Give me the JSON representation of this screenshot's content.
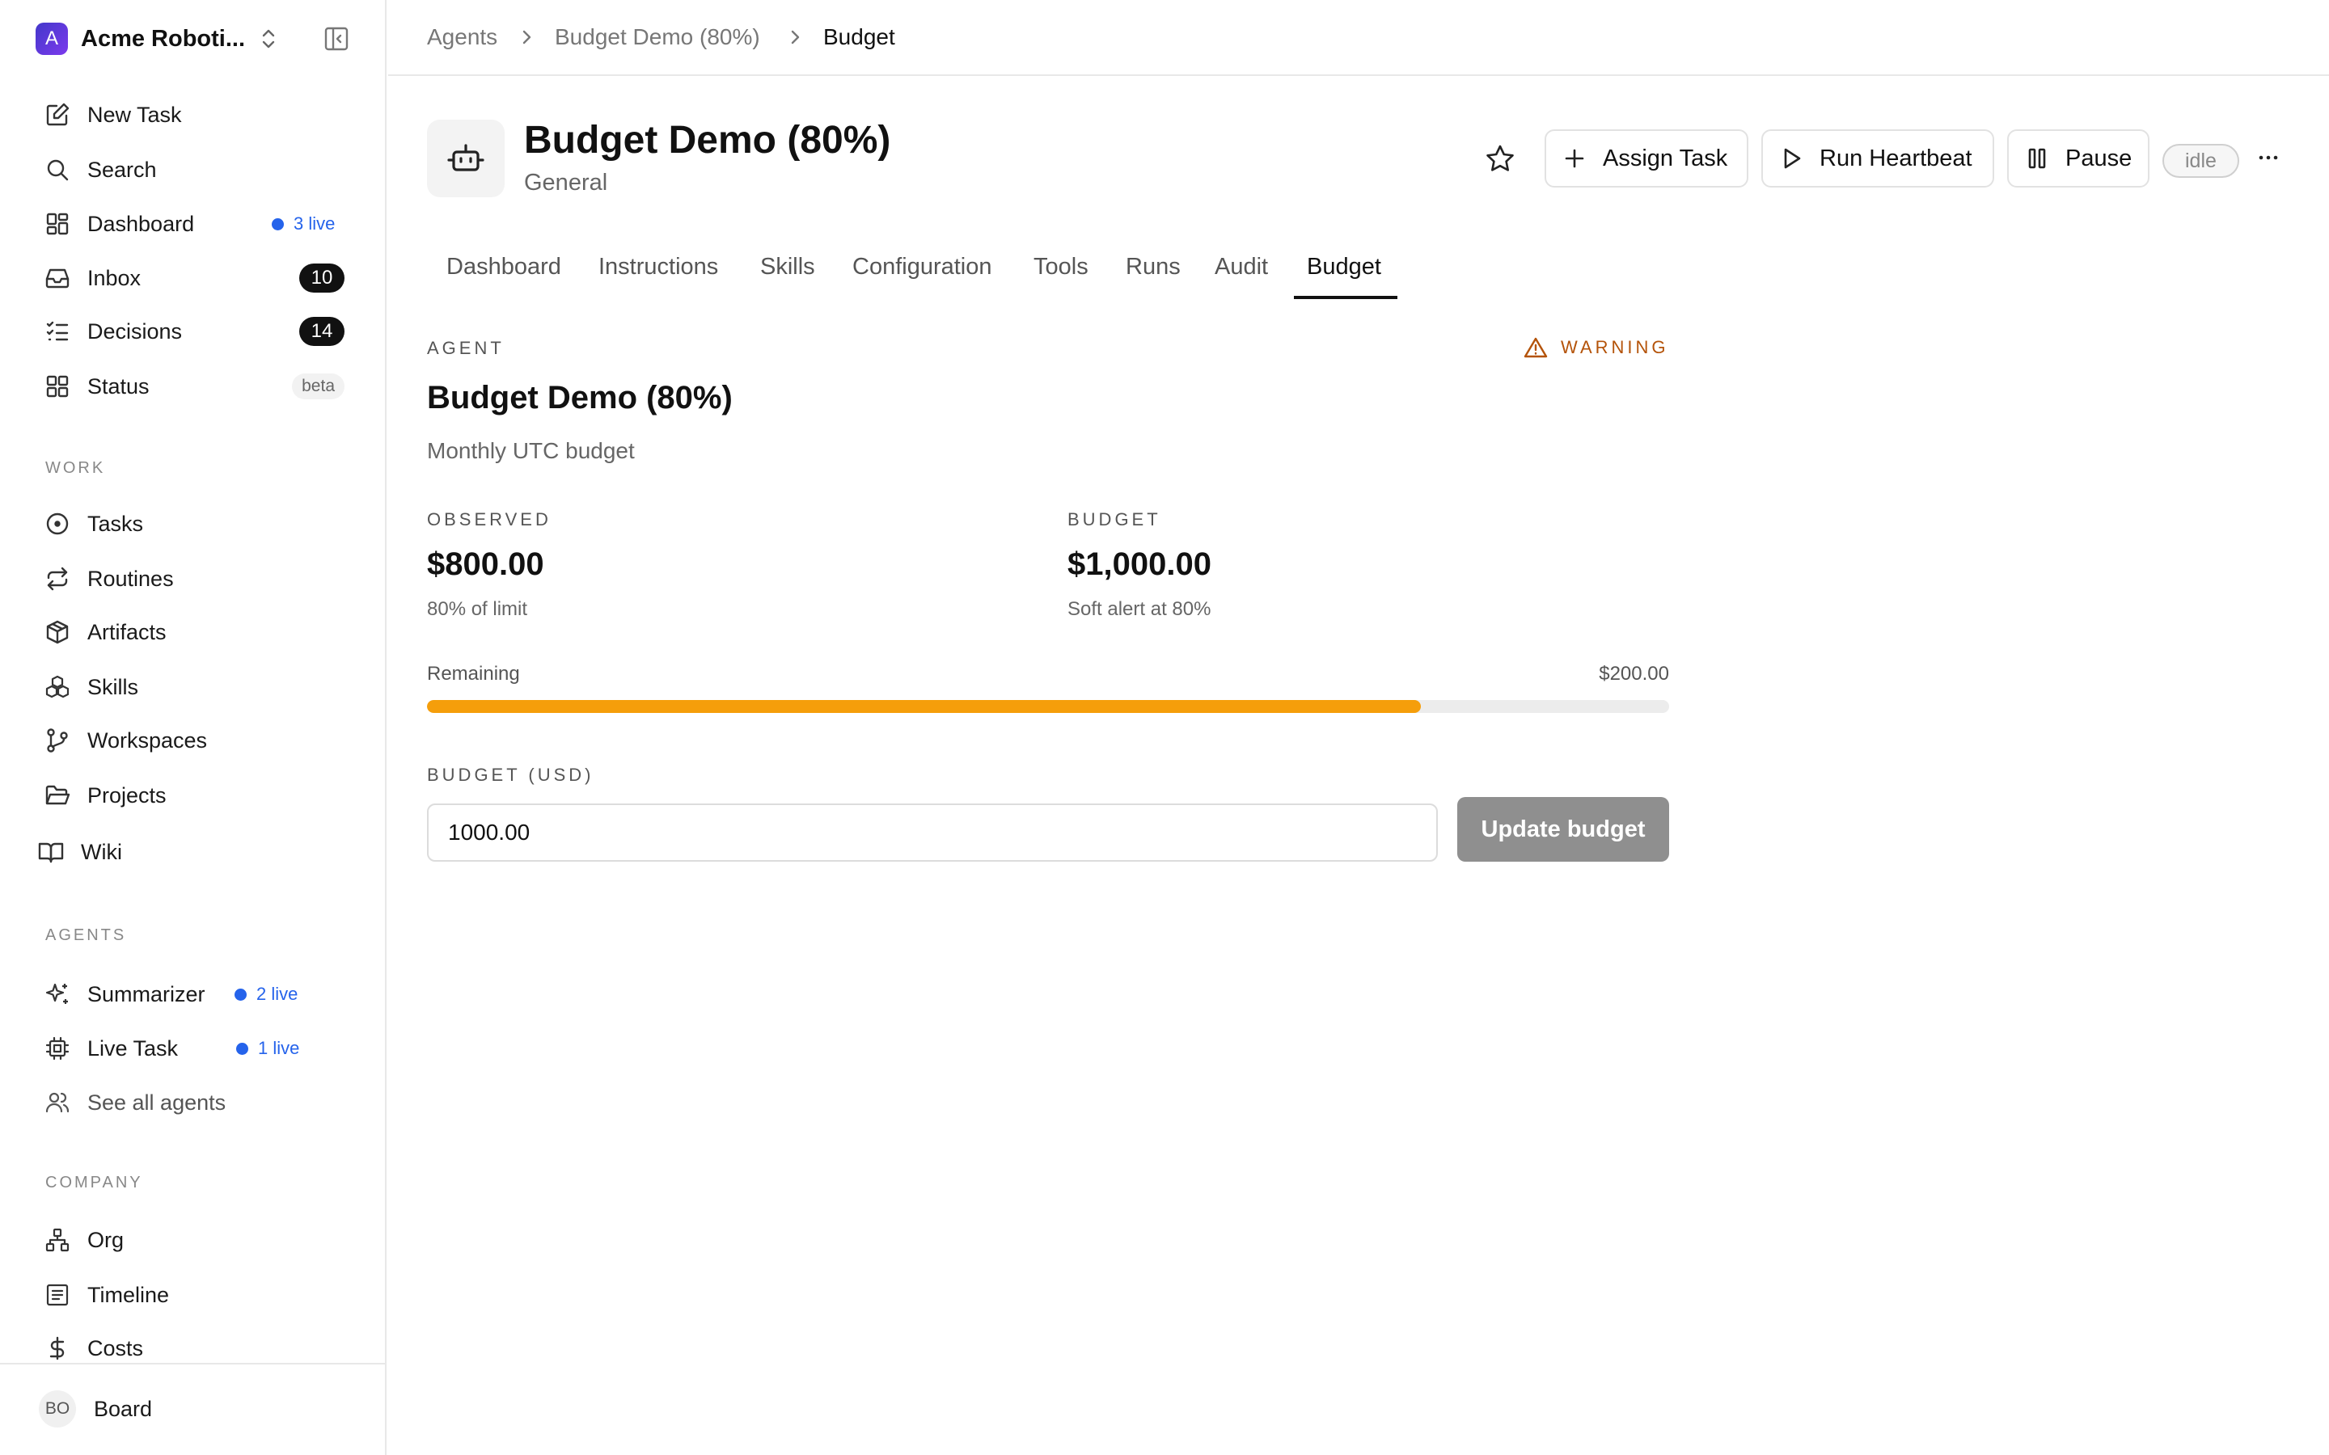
{
  "sidebar": {
    "company_name": "Acme Roboti...",
    "company_initial": "A",
    "nav": {
      "new_task": "New Task",
      "search": "Search",
      "dashboard": "Dashboard",
      "dashboard_live": "3 live",
      "inbox": "Inbox",
      "inbox_count": "10",
      "decisions": "Decisions",
      "decisions_count": "14",
      "status": "Status",
      "status_badge": "beta"
    },
    "work": {
      "label": "WORK",
      "items": [
        "Tasks",
        "Routines",
        "Artifacts",
        "Skills",
        "Workspaces",
        "Projects",
        "Wiki"
      ]
    },
    "agents": {
      "label": "AGENTS",
      "items": [
        {
          "name": "Summarizer",
          "live": "2 live"
        },
        {
          "name": "Live Task",
          "live": "1 live"
        }
      ],
      "see_all": "See all agents"
    },
    "company": {
      "label": "COMPANY",
      "items": [
        "Org",
        "Timeline",
        "Costs"
      ]
    },
    "footer": {
      "avatar_initials": "BO",
      "label": "Board"
    }
  },
  "breadcrumb": [
    "Agents",
    "Budget Demo (80%)",
    "Budget"
  ],
  "header": {
    "title": "Budget Demo (80%)",
    "subtitle": "General",
    "assign_task": "Assign Task",
    "run_heartbeat": "Run Heartbeat",
    "pause": "Pause",
    "status": "idle",
    "more": "···"
  },
  "tabs": [
    "Dashboard",
    "Instructions",
    "Skills",
    "Configuration",
    "Tools",
    "Runs",
    "Audit",
    "Budget"
  ],
  "active_tab": "Budget",
  "budget_card": {
    "agent_caption": "AGENT",
    "warning": "WARNING",
    "agent_name": "Budget Demo (80%)",
    "period": "Monthly UTC budget",
    "observed_caption": "OBSERVED",
    "observed_value": "$800.00",
    "observed_note": "80% of limit",
    "budget_caption": "BUDGET",
    "budget_value": "$1,000.00",
    "budget_note": "Soft alert at 80%",
    "remaining_label": "Remaining",
    "remaining_value": "$200.00",
    "progress_fraction": 0.8,
    "progress_color": "#f59e0b",
    "warning_color": "#b45309",
    "input_label": "BUDGET (USD)",
    "input_value": "1000.00",
    "update_button": "Update budget"
  }
}
